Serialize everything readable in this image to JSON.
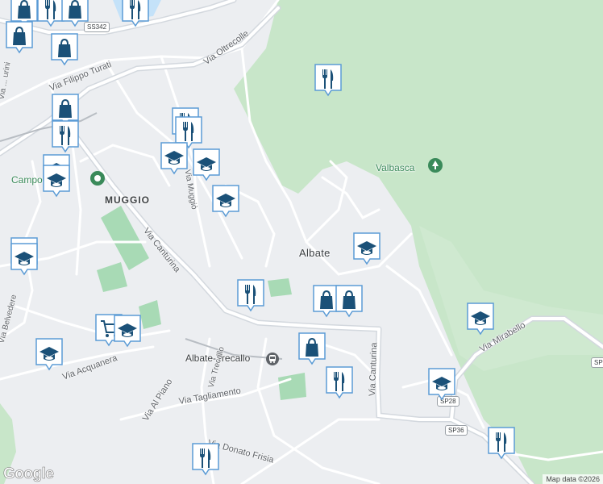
{
  "map": {
    "places": {
      "albate": "Albate",
      "muggio": "MUGGIO",
      "valbasca": "Valbasca",
      "campo": "Campo CONI",
      "station": "Albate-Trecallo"
    },
    "streets": {
      "via_oltrecolle": "Via Oltrecolle",
      "via_filippo_turati": "Via Filippo Turati",
      "via_canturina_1": "Via Canturina",
      "via_canturina_2": "Via Canturina",
      "via_muggio": "Via Muggiò",
      "via_belvedere": "Via Belvedere",
      "via_acquanera": "Via Acquanera",
      "via_al_piano": "Via Al Piano",
      "via_tagliamento": "Via Tagliamento",
      "via_trecallo": "Via Trecallo",
      "via_mirabello": "Via Mirabello",
      "via_frisia": "Via Donato Frisia",
      "via_partial": "Via ... urini"
    },
    "shields": {
      "ss342": "SS342",
      "sp28": "SP28",
      "sp36": "SP36",
      "sp_right": "SP"
    },
    "google_logo": "Google",
    "attribution": "Map data ©2026",
    "colors": {
      "land": "#eceef1",
      "forest": "#c8e6c9",
      "park": "#a8dab5",
      "road": "#ffffff",
      "road_major": "#d3d8de",
      "water": "#aadaff",
      "pin": "#1b5178"
    }
  },
  "markers": [
    {
      "type": "shopping",
      "label": "shopping-bag-icon"
    },
    {
      "type": "restaurant",
      "label": "restaurant-icon"
    },
    {
      "type": "school",
      "label": "school-icon"
    },
    {
      "type": "grocery",
      "label": "grocery-cart-icon"
    }
  ]
}
